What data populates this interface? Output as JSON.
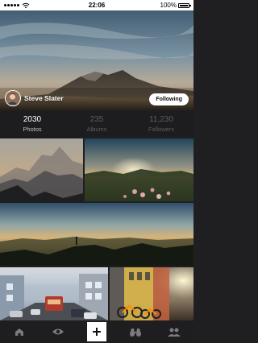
{
  "status_bar": {
    "time": "22:06",
    "battery": "100%",
    "battery_level": 1.0
  },
  "profile": {
    "name": "Steve Slater",
    "follow_label": "Following"
  },
  "stats": [
    {
      "value": "2030",
      "label": "Photos",
      "active": true
    },
    {
      "value": "235",
      "label": "Albums",
      "active": false
    },
    {
      "value": "11,230",
      "label": "Followers",
      "active": false
    }
  ],
  "bottom_nav": {
    "items": [
      {
        "icon": "home-icon"
      },
      {
        "icon": "eye-icon"
      },
      {
        "icon": "plus-icon",
        "active": true
      },
      {
        "icon": "binoculars-icon"
      },
      {
        "icon": "people-icon"
      }
    ]
  },
  "colors": {
    "background": "#1f1f21",
    "stat_active": "#ffffff",
    "stat_inactive": "#5d5d62",
    "accent_white": "#ffffff"
  }
}
